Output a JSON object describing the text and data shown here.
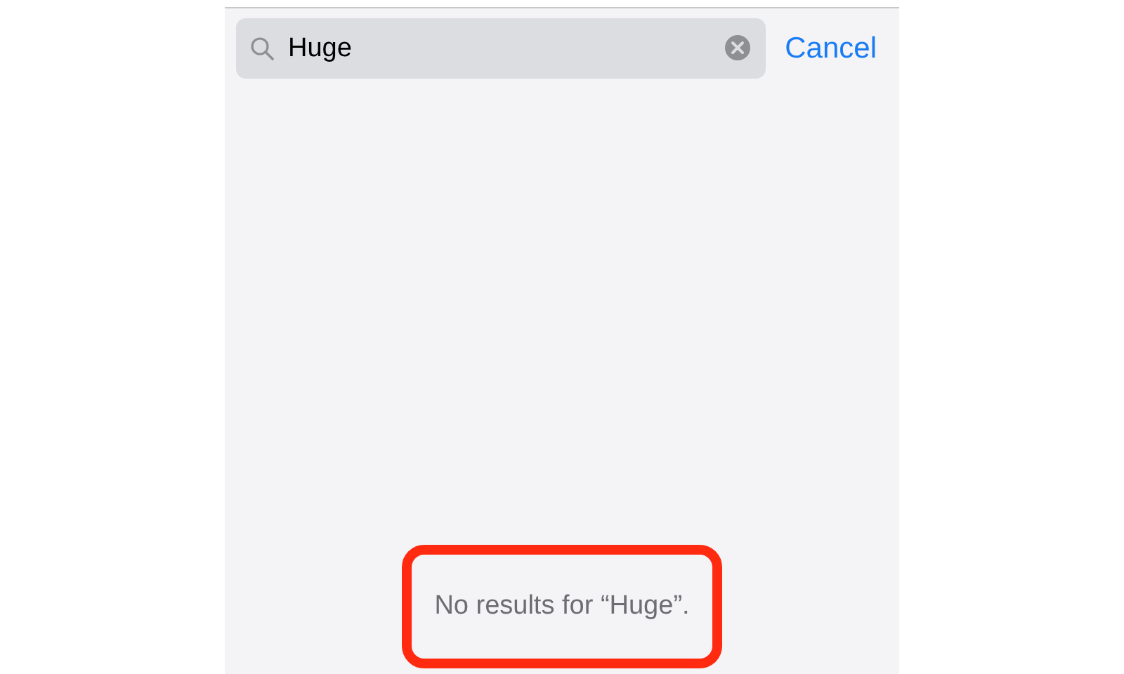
{
  "search": {
    "value": "Huge",
    "clear_button": true
  },
  "cancel": {
    "label": "Cancel"
  },
  "message": {
    "text": "No results for “Huge”.",
    "highlighted": true
  }
}
